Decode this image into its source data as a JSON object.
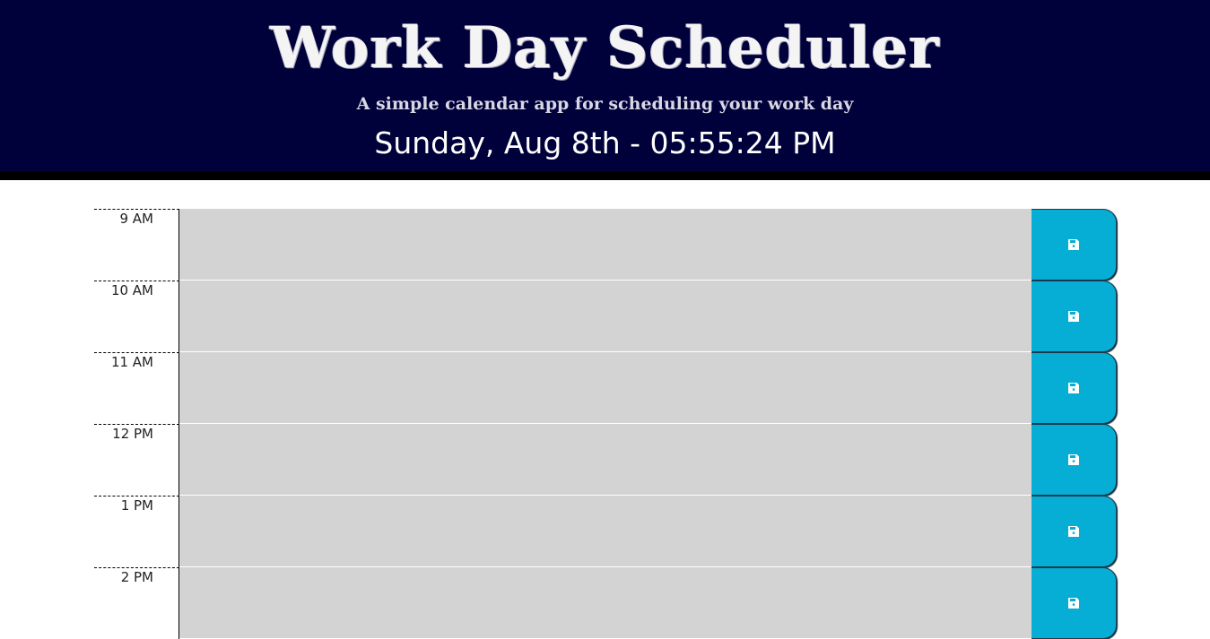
{
  "header": {
    "title": "Work Day Scheduler",
    "subtitle": "A simple calendar app for scheduling your work day",
    "current_day": "Sunday, Aug 8th - 05:55:24 PM"
  },
  "colors": {
    "header_background": "#00003a",
    "header_border": "#000000",
    "block_past": "#d3d3d3",
    "save_button": "#06aed5"
  },
  "schedule": {
    "blocks": [
      {
        "hour": "9 AM",
        "text": "",
        "save_icon": "save-icon"
      },
      {
        "hour": "10 AM",
        "text": "",
        "save_icon": "save-icon"
      },
      {
        "hour": "11 AM",
        "text": "",
        "save_icon": "save-icon"
      },
      {
        "hour": "12 PM",
        "text": "",
        "save_icon": "save-icon"
      },
      {
        "hour": "1 PM",
        "text": "",
        "save_icon": "save-icon"
      },
      {
        "hour": "2 PM",
        "text": "",
        "save_icon": "save-icon"
      }
    ]
  }
}
